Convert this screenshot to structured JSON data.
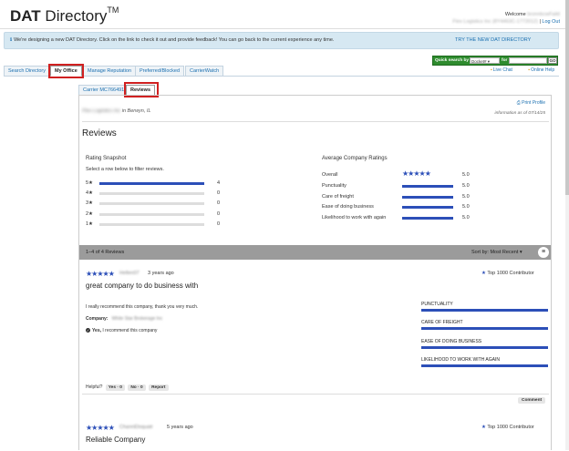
{
  "header": {
    "logo_bold": "DAT",
    "logo_rest": " Directory",
    "logo_tm": "TM",
    "welcome_prefix": "Welcome",
    "user_name": "bronnbcwFaild",
    "account_line": "Flex Logistics Inc (8Y4463C-1772012)",
    "logout_label": "Log Out"
  },
  "banner": {
    "message": "We're designing a new DAT Directory. Click on the link to check it out and provide feedback! You can go back to the current experience any time.",
    "link_label": "TRY THE NEW DAT DIRECTORY"
  },
  "quick_search": {
    "label": "Quick search by",
    "selected": "Docket#",
    "for_label": "for",
    "value": "",
    "go_label": "GO"
  },
  "tools": {
    "live_chat": "Live Chat",
    "online_help": "Online Help"
  },
  "tabs": [
    {
      "label": "Search Directory"
    },
    {
      "label": "My Office"
    },
    {
      "label": "Manage Reputation"
    },
    {
      "label": "Preferred/Blocked"
    },
    {
      "label": "CarrierWatch"
    }
  ],
  "subtabs": [
    {
      "label": "Carrier MC766491"
    },
    {
      "label": "Reviews"
    }
  ],
  "company": {
    "name": "Flex Logistics Inc",
    "location": "in Berwyn, IL",
    "print_label": "Print Profile",
    "as_of": "information as of 07/14/25"
  },
  "reviews_heading": "Reviews",
  "rating_snapshot": {
    "title": "Rating Snapshot",
    "subtitle": "Select a row below to filter reviews.",
    "rows": [
      {
        "label": "5★",
        "count": "4",
        "fraction": 1.0
      },
      {
        "label": "4★",
        "count": "0",
        "fraction": 0
      },
      {
        "label": "3★",
        "count": "0",
        "fraction": 0
      },
      {
        "label": "2★",
        "count": "0",
        "fraction": 0
      },
      {
        "label": "1★",
        "count": "0",
        "fraction": 0
      }
    ]
  },
  "average_ratings": {
    "title": "Average Company Ratings",
    "rows": [
      {
        "label": "Overall",
        "value": "5.0",
        "display": "stars"
      },
      {
        "label": "Punctuality",
        "value": "5.0",
        "display": "bar"
      },
      {
        "label": "Care of freight",
        "value": "5.0",
        "display": "bar"
      },
      {
        "label": "Ease of doing business",
        "value": "5.0",
        "display": "bar"
      },
      {
        "label": "Likelihood to work with again",
        "value": "5.0",
        "display": "bar"
      }
    ]
  },
  "list_bar": {
    "count_text": "1–4 of 4 Reviews",
    "sort_text": "Sort by: Most Recent ▾",
    "menu_icon": "≡"
  },
  "reviews": [
    {
      "stars": "★★★★★",
      "user": "Hellen07",
      "ago": "3 years ago",
      "badge": "Top 1000 Contributor",
      "title": "great company to do business with",
      "body": "I really recommend this company, thank you very much.",
      "company_label": "Company:",
      "company_value": "White Star Brokerage Inc",
      "recommend_yes": "Yes,",
      "recommend_text": "I recommend this company",
      "categories": [
        "PUNCTUALITY",
        "CARE OF FREIGHT",
        "EASE OF DOING BUSINESS",
        "LIKELIHOOD TO WORK WITH AGAIN"
      ],
      "helpful_label": "Helpful?",
      "yes_label": "Yes · 0",
      "no_label": "No · 0",
      "report_label": "Report",
      "comment_label": "Comment"
    },
    {
      "stars": "★★★★★",
      "user": "ChannEloquatr",
      "ago": "5 years ago",
      "badge": "Top 1000 Contributor",
      "title": "Reliable Company"
    }
  ],
  "colors": {
    "accent_blue": "#2c4fb8",
    "link_blue": "#1a6fb0",
    "highlight_red": "#d02020",
    "quick_search_green": "#2e8b2e"
  }
}
